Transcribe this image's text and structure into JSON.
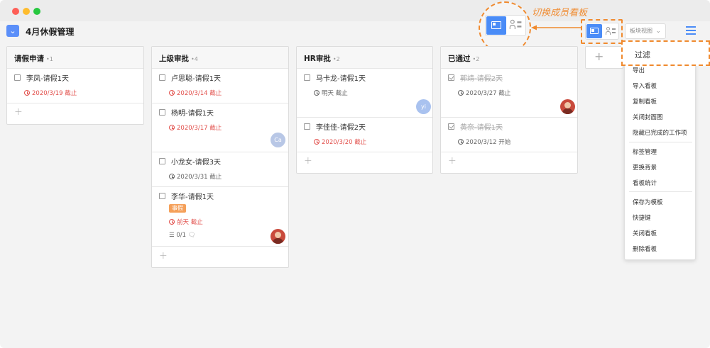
{
  "board": {
    "title": "4月休假管理"
  },
  "annotation": {
    "label": "切换成员看板"
  },
  "view_select": {
    "value": "板块视图"
  },
  "columns": [
    {
      "title": "请假申请",
      "count": "•1",
      "cards": [
        {
          "title": "李凤-请假1天",
          "due": "2020/3/19 截止"
        }
      ]
    },
    {
      "title": "上级审批",
      "count": "•4",
      "cards": [
        {
          "title": "卢思聪-请假1天",
          "due": "2020/3/14 截止"
        },
        {
          "title": "杨明-请假1天",
          "due": "2020/3/17 截止",
          "avatar": "Ca"
        },
        {
          "title": "小龙女-请假3天",
          "due": "2020/3/31 截止"
        },
        {
          "title": "李华-请假1天",
          "tag": "事假",
          "due": "前天 截止",
          "subtasks": "0/1"
        }
      ]
    },
    {
      "title": "HR审批",
      "count": "•2",
      "cards": [
        {
          "title": "马卡龙-请假1天",
          "due": "明天 截止",
          "avatar": "yi"
        },
        {
          "title": "李佳佳-请假2天",
          "due": "2020/3/20 截止"
        }
      ]
    },
    {
      "title": "已通过",
      "count": "•2",
      "cards": [
        {
          "title": "郭靖-请假2天",
          "due": "2020/3/27 截止"
        },
        {
          "title": "黄奈-请假1天",
          "due": "2020/3/12 开始"
        }
      ]
    }
  ],
  "menu": {
    "filter": "过滤",
    "items": [
      "导出",
      "导入看板",
      "复制看板",
      "关闭封面图",
      "隐藏已完成的工作项",
      "标签管理",
      "更换背景",
      "看板统计",
      "保存为模板",
      "快捷键",
      "关闭看板",
      "删除看板"
    ]
  },
  "colors": {
    "accent": "#4a8cf7",
    "annotation": "#f08a2e",
    "due_red": "#e2504c",
    "tag": "#f5a05a"
  }
}
